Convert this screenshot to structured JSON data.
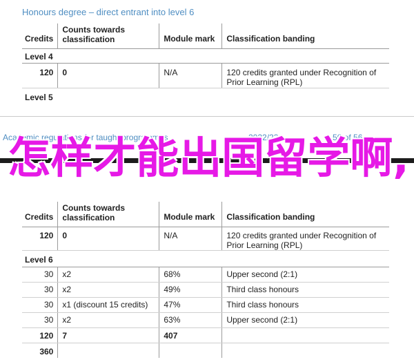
{
  "section1": {
    "heading": "Honours degree – direct entrant into level 6",
    "headers": {
      "credits": "Credits",
      "counts": "Counts towards classification",
      "mark": "Module mark",
      "banding": "Classification banding"
    },
    "level4": {
      "label": "Level 4",
      "credits": "120",
      "counts": "0",
      "mark": "N/A",
      "banding": "120 credits granted under Recognition of Prior Learning (RPL)"
    },
    "level5": {
      "label": "Level 5"
    }
  },
  "footer": {
    "left": "Academic regulations for taught programmes",
    "year": "2022/23",
    "page": "50 of 56"
  },
  "overlay_text": "怎样才能出国留学啊,",
  "section2": {
    "headers": {
      "credits": "Credits",
      "counts": "Counts towards classification",
      "mark": "Module mark",
      "banding": "Classification banding"
    },
    "level5": {
      "credits": "120",
      "counts": "0",
      "mark": "N/A",
      "banding": "120 credits granted under Recognition of Prior Learning (RPL)"
    },
    "level6": {
      "label": "Level 6",
      "rows": [
        {
          "credits": "30",
          "counts": "x2",
          "mark": "68%",
          "banding": "Upper second (2:1)"
        },
        {
          "credits": "30",
          "counts": "x2",
          "mark": "49%",
          "banding": "Third class honours"
        },
        {
          "credits": "30",
          "counts": "x1 (discount 15 credits)",
          "mark": "47%",
          "banding": "Third class honours"
        },
        {
          "credits": "30",
          "counts": "x2",
          "mark": "63%",
          "banding": "Upper second (2:1)"
        }
      ],
      "total": {
        "credits": "120",
        "counts": "7",
        "mark": "407"
      },
      "grand_total": "360"
    }
  }
}
